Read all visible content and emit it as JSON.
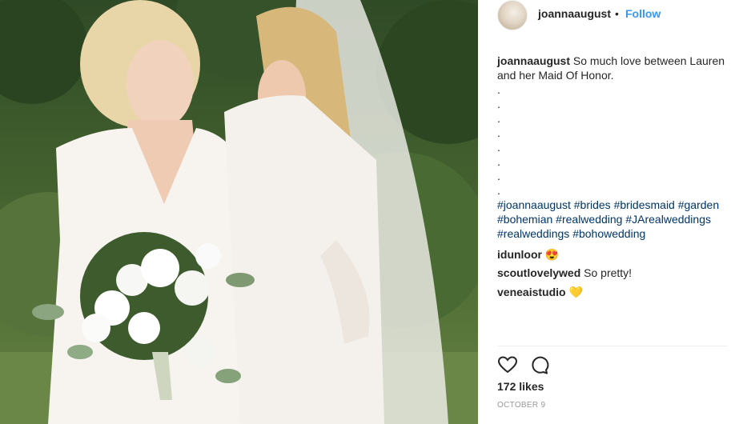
{
  "post": {
    "username": "joannaaugust",
    "separator": "•",
    "follow_label": "Follow",
    "caption": {
      "author": "joannaaugust",
      "text": "So much love between Lauren and her Maid Of Honor.",
      "dots": [
        ".",
        ".",
        ".",
        ".",
        ".",
        ".",
        ".",
        "."
      ],
      "hashtags": [
        "#joannaaugust",
        "#brides",
        "#bridesmaid",
        "#garden",
        "#bohemian",
        "#realwedding",
        "#JArealweddings",
        "#realweddings",
        "#bohowedding"
      ]
    },
    "comments": [
      {
        "user": "idunloor",
        "text": "",
        "emoji": "😍"
      },
      {
        "user": "scoutlovelywed",
        "text": "So pretty!",
        "emoji": ""
      },
      {
        "user": "veneaistudio",
        "text": "",
        "emoji": "💛"
      }
    ],
    "likes": "172 likes",
    "date": "OCTOBER 9"
  },
  "icons": {
    "like": "heart-icon",
    "comment": "comment-bubble-icon"
  },
  "colors": {
    "link_blue": "#3897f0",
    "hashtag": "#003569",
    "text": "#262626",
    "muted": "#999999"
  }
}
